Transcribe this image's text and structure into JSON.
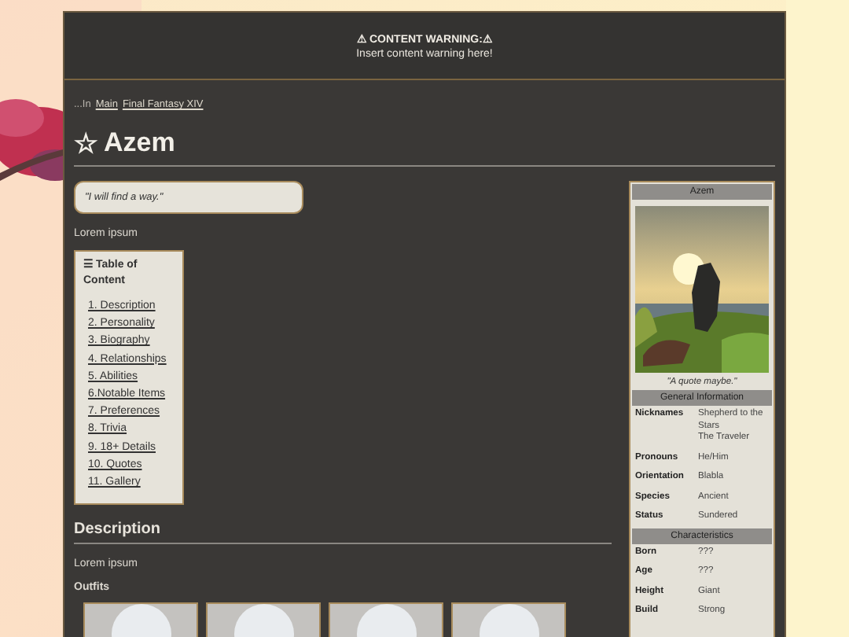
{
  "warning": {
    "title": "⚠ CONTENT WARNING:⚠",
    "text": "Insert content warning here!"
  },
  "breadcrumb": {
    "prefix": "...In",
    "links": [
      "Main",
      "Final Fantasy XIV"
    ]
  },
  "page_title": {
    "star": "☆",
    "text": "Azem"
  },
  "quote": "\"I will find a way.\"",
  "intro": "Lorem ipsum",
  "toc": {
    "icon": "☰",
    "title": "Table of Content",
    "items": [
      "1. Description",
      "2. Personality",
      "3. Biography",
      "4. Relationships",
      "5. Abilities",
      "6.Notable Items",
      "7. Preferences",
      "8. Trivia",
      "9. 18+ Details",
      "10. Quotes",
      "11. Gallery"
    ]
  },
  "description": {
    "heading": "Description",
    "text": "Lorem ipsum",
    "outfits_label": "Outfits",
    "outfits": [
      {
        "kind": "placeholder"
      },
      {
        "kind": "placeholder"
      },
      {
        "kind": "placeholder"
      },
      {
        "kind": "placeholder"
      }
    ]
  },
  "infobox": {
    "title": "Azem",
    "caption": "\"A quote maybe.\"",
    "sections": [
      {
        "heading": "General Information",
        "rows": [
          {
            "label": "Nicknames",
            "values": [
              "Shepherd to the Stars",
              "The Traveler"
            ]
          },
          {
            "label": "Pronouns",
            "values": [
              "He/Him"
            ]
          },
          {
            "label": "Orientation",
            "values": [
              "Blabla"
            ]
          },
          {
            "label": "Species",
            "values": [
              "Ancient"
            ]
          },
          {
            "label": "Status",
            "values": [
              "Sundered"
            ]
          }
        ]
      },
      {
        "heading": "Characteristics",
        "rows": [
          {
            "label": "Born",
            "values": [
              "???"
            ]
          },
          {
            "label": "Age",
            "values": [
              "???"
            ]
          },
          {
            "label": "Height",
            "values": [
              "Giant"
            ]
          },
          {
            "label": "Build",
            "values": [
              "Strong"
            ]
          }
        ]
      }
    ]
  }
}
